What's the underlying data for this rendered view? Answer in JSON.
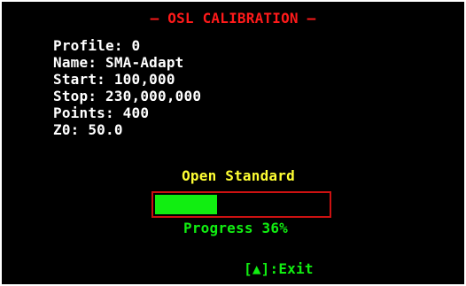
{
  "header": {
    "title": "— OSL CALIBRATION —"
  },
  "profile": {
    "lines": [
      "Profile: 0",
      "Name: SMA-Adapt",
      "Start: 100,000",
      "Stop: 230,000,000",
      "Points: 400",
      "Z0: 50.0"
    ]
  },
  "calibration": {
    "standard_label": "Open Standard",
    "progress_fraction": 0.36,
    "progress_text": "Progress 36%"
  },
  "footer": {
    "exit_label": "[▲]:Exit"
  },
  "colors": {
    "background": "#000000",
    "title": "#ff1a1a",
    "info_text": "#ffffff",
    "standard_text": "#ffff33",
    "progress": "#11ee11",
    "bar_border": "#cc1111"
  }
}
